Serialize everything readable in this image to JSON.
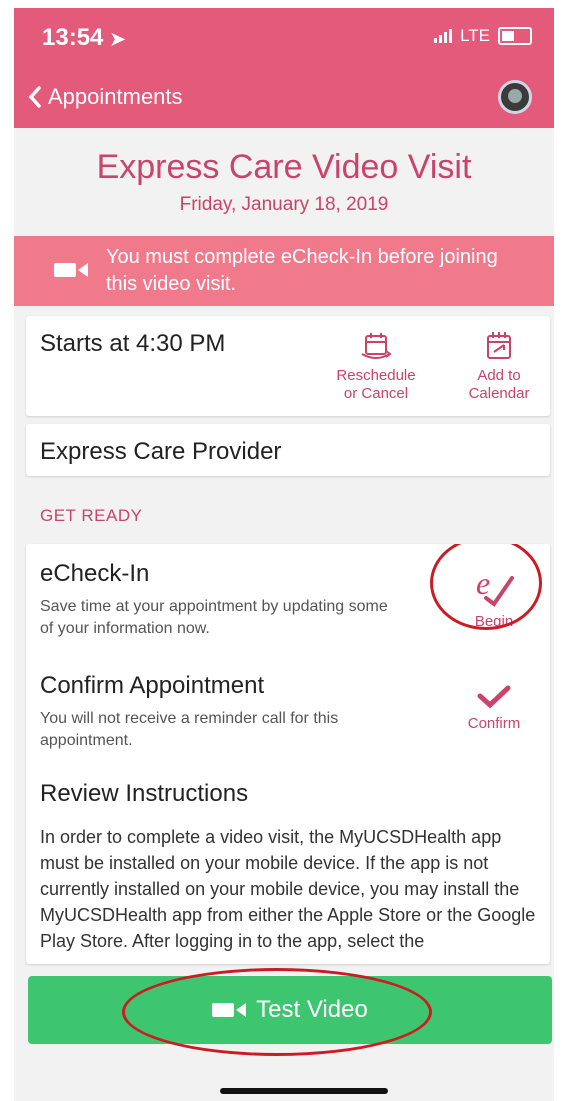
{
  "status_bar": {
    "time": "13:54",
    "network": "LTE"
  },
  "nav": {
    "back_label": "Appointments"
  },
  "header": {
    "title": "Express Care Video Visit",
    "date": "Friday, January 18, 2019"
  },
  "alert": {
    "text": "You must complete eCheck-In before joining this video visit."
  },
  "appointment": {
    "starts_text": "Starts at 4:30 PM",
    "reschedule_line1": "Reschedule",
    "reschedule_line2": "or Cancel",
    "calendar_line1": "Add to",
    "calendar_line2": "Calendar",
    "provider": "Express Care Provider"
  },
  "get_ready": {
    "section_label": "GET READY",
    "tasks": [
      {
        "title": "eCheck-In",
        "desc": "Save time at your appointment by updating some of your information now.",
        "action": "Begin"
      },
      {
        "title": "Confirm Appointment",
        "desc": "You will not receive a reminder call for this appointment.",
        "action": "Confirm"
      },
      {
        "title": "Review Instructions",
        "desc": "In order to complete a video visit, the MyUCSDHealth app must be installed on your mobile device. If the app is not currently installed on your mobile device, you may install the MyUCSDHealth app from either the Apple Store or the Google Play Store. After logging in to the app, select the"
      }
    ]
  },
  "test_video": {
    "label": "Test Video"
  },
  "colors": {
    "brand": "#e35a7a",
    "accent": "#c9436a",
    "alert": "#f07a8c",
    "button": "#3dc56f",
    "annotation": "#c91c25"
  },
  "icons": [
    "location-arrow-icon",
    "signal-icon",
    "battery-icon",
    "chevron-left-icon",
    "avatar",
    "video-camera-icon",
    "reschedule-icon",
    "calendar-icon",
    "echeckin-icon",
    "checkmark-icon"
  ]
}
